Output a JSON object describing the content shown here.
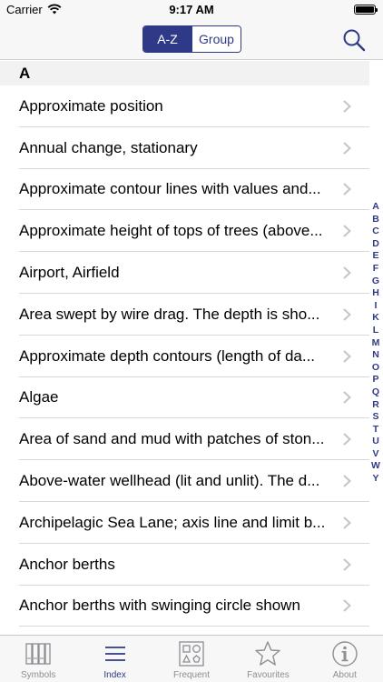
{
  "status_bar": {
    "carrier": "Carrier",
    "time": "9:17 AM"
  },
  "nav": {
    "segments": [
      {
        "label": "A-Z",
        "active": true
      },
      {
        "label": "Group",
        "active": false
      }
    ],
    "search_icon": "search-icon"
  },
  "section": {
    "title": "A"
  },
  "items": [
    {
      "label": "Approximate position"
    },
    {
      "label": "Annual change, stationary"
    },
    {
      "label": "Approximate contour lines with values and..."
    },
    {
      "label": "Approximate height of tops of trees (above..."
    },
    {
      "label": "Airport, Airfield"
    },
    {
      "label": "Area swept by wire drag.  The depth is sho..."
    },
    {
      "label": "Approximate depth contours (length of da..."
    },
    {
      "label": "Algae"
    },
    {
      "label": "Area of sand and mud with patches of ston..."
    },
    {
      "label": "Above-water wellhead (lit and unlit).  The d..."
    },
    {
      "label": "Archipelagic Sea Lane; axis line and limit b..."
    },
    {
      "label": "Anchor berths"
    },
    {
      "label": "Anchor berths with swinging circle shown"
    }
  ],
  "index_letters": [
    "A",
    "B",
    "C",
    "D",
    "E",
    "F",
    "G",
    "H",
    "I",
    "K",
    "L",
    "M",
    "N",
    "O",
    "P",
    "Q",
    "R",
    "S",
    "T",
    "U",
    "V",
    "W",
    "Y"
  ],
  "tabs": [
    {
      "label": "Symbols",
      "icon": "books-icon",
      "active": false
    },
    {
      "label": "Index",
      "icon": "list-icon",
      "active": true
    },
    {
      "label": "Frequent",
      "icon": "shapes-icon",
      "active": false
    },
    {
      "label": "Favourites",
      "icon": "star-icon",
      "active": false
    },
    {
      "label": "About",
      "icon": "info-icon",
      "active": false
    }
  ],
  "colors": {
    "accent": "#2e3a87",
    "inactive": "#8e8e93"
  }
}
